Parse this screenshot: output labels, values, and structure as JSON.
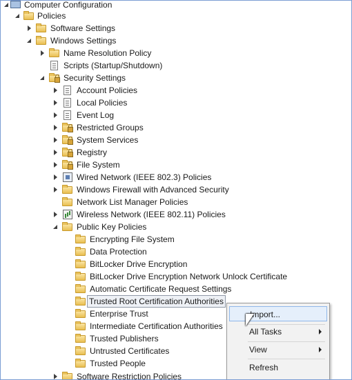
{
  "tree": {
    "computer_configuration": "Computer Configuration",
    "policies": "Policies",
    "software_settings": "Software Settings",
    "windows_settings": "Windows Settings",
    "name_resolution_policy": "Name Resolution Policy",
    "scripts": "Scripts (Startup/Shutdown)",
    "security_settings": "Security Settings",
    "account_policies": "Account Policies",
    "local_policies": "Local Policies",
    "event_log": "Event Log",
    "restricted_groups": "Restricted Groups",
    "system_services": "System Services",
    "registry": "Registry",
    "file_system": "File System",
    "wired_network": "Wired Network (IEEE 802.3) Policies",
    "windows_firewall": "Windows Firewall with Advanced Security",
    "network_list_manager": "Network List Manager Policies",
    "wireless_network": "Wireless Network (IEEE 802.11) Policies",
    "public_key_policies": "Public Key Policies",
    "encrypting_file_system": "Encrypting File System",
    "data_protection": "Data Protection",
    "bitlocker": "BitLocker Drive Encryption",
    "bitlocker_network_unlock": "BitLocker Drive Encryption Network Unlock Certificate",
    "auto_cert_request": "Automatic Certificate Request Settings",
    "trusted_root": "Trusted Root Certification Authorities",
    "enterprise_trust": "Enterprise Trust",
    "intermediate_ca": "Intermediate Certification Authorities",
    "trusted_publishers": "Trusted Publishers",
    "untrusted_certificates": "Untrusted Certificates",
    "trusted_people": "Trusted People",
    "software_restriction": "Software Restriction Policies"
  },
  "context_menu": {
    "import": "Import...",
    "all_tasks": "All Tasks",
    "view": "View",
    "refresh": "Refresh"
  }
}
